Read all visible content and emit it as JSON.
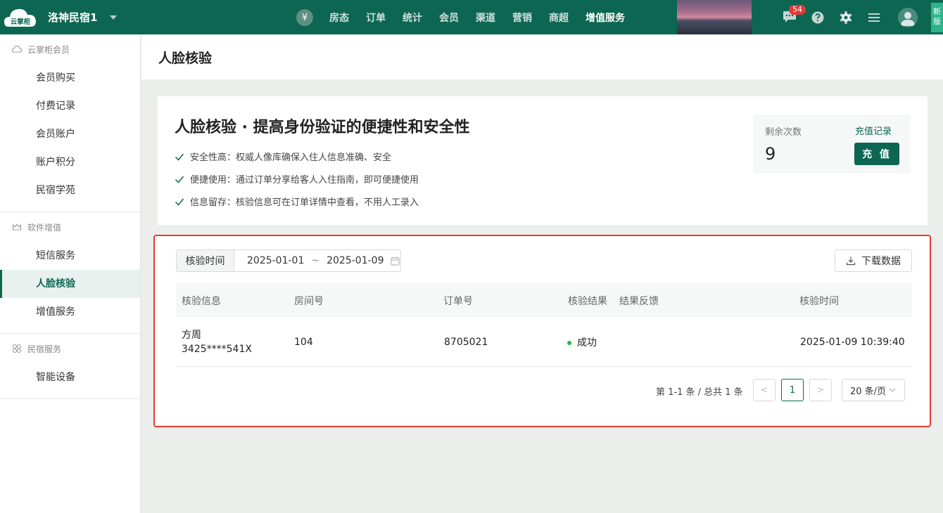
{
  "topbar": {
    "logo_text": "云掌柜",
    "hotel_name": "洛神民宿1",
    "yen_symbol": "¥",
    "nav": [
      "房态",
      "订单",
      "统计",
      "会员",
      "渠道",
      "营销",
      "商超",
      "增值服务"
    ],
    "active_nav": "增值服务",
    "message_count": "54",
    "new_version": "新版",
    "colors": {
      "primary": "#0d6652",
      "badge": "#e53935"
    }
  },
  "sidebar": {
    "groups": [
      {
        "title": "云掌柜会员",
        "icon": "cloud-icon",
        "items": [
          "会员购买",
          "付费记录",
          "会员账户",
          "账户积分",
          "民宿学苑"
        ]
      },
      {
        "title": "软件增值",
        "icon": "crown-icon",
        "items": [
          "短信服务",
          "人脸核验",
          "增值服务"
        ]
      },
      {
        "title": "民宿服务",
        "icon": "grid-icon",
        "items": [
          "智能设备"
        ]
      }
    ],
    "active_item": "人脸核验"
  },
  "page": {
    "title": "人脸核验"
  },
  "intro": {
    "headline": "人脸核验 · 提高身份验证的便捷性和安全性",
    "features": [
      "安全性高：权威人像库确保入住人信息准确、安全",
      "便捷使用：通过订单分享给客人入住指南，即可便捷使用",
      "信息留存：核验信息可在订单详情中查看，不用人工录入"
    ],
    "quota": {
      "label": "剩余次数",
      "value": "9",
      "history_link": "充值记录",
      "recharge_button": "充 值"
    }
  },
  "records": {
    "filter_label": "核验时间",
    "date_start": "2025-01-01",
    "date_sep": "~",
    "date_end": "2025-01-09",
    "download_label": "下载数据",
    "columns": [
      "核验信息",
      "房间号",
      "订单号",
      "核验结果",
      "结果反馈",
      "核验时间"
    ],
    "rows": [
      {
        "guest_name": "方周",
        "id_number": "3425****541X",
        "room": "104",
        "order_no": "8705021",
        "result": "成功",
        "feedback": "",
        "time": "2025-01-09 10:39:40"
      }
    ],
    "pagination": {
      "summary": "第 1-1 条 / 总共 1 条",
      "prev": "<",
      "current_page": "1",
      "next": ">",
      "page_size": "20 条/页"
    }
  }
}
